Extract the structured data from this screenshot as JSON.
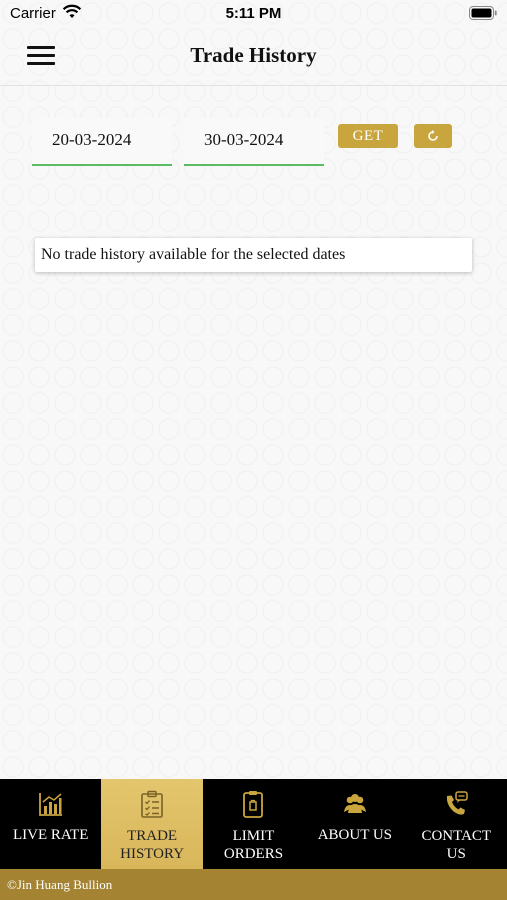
{
  "status_bar": {
    "carrier": "Carrier",
    "time": "5:11 PM",
    "icons": [
      "wifi-icon",
      "battery-icon"
    ]
  },
  "nav": {
    "title": "Trade History",
    "menu_icon": "hamburger-menu-icon"
  },
  "filters": {
    "from_date": "20-03-2024",
    "to_date": "30-03-2024",
    "get_label": "GET",
    "refresh_icon": "refresh-icon"
  },
  "results": {
    "empty_message": "No trade history available for the selected dates"
  },
  "tabs": [
    {
      "line1": "LIVE RATE",
      "line2": "",
      "icon": "bar-chart-icon",
      "active": false
    },
    {
      "line1": "TRADE",
      "line2": "HISTORY",
      "icon": "clipboard-icon",
      "active": true
    },
    {
      "line1": "LIMIT",
      "line2": "ORDERS",
      "icon": "order-icon",
      "active": false
    },
    {
      "line1": "ABOUT US",
      "line2": "",
      "icon": "people-icon",
      "active": false
    },
    {
      "line1": "CONTACT",
      "line2": "US",
      "icon": "phone-chat-icon",
      "active": false
    }
  ],
  "footer": {
    "copyright": "©Jin Huang Bullion"
  },
  "colors": {
    "gold": "#c9a53d",
    "active_tab": "#e3c66d",
    "footer": "#a48333",
    "underline": "#5dbb63",
    "tab_bar": "#000000"
  }
}
